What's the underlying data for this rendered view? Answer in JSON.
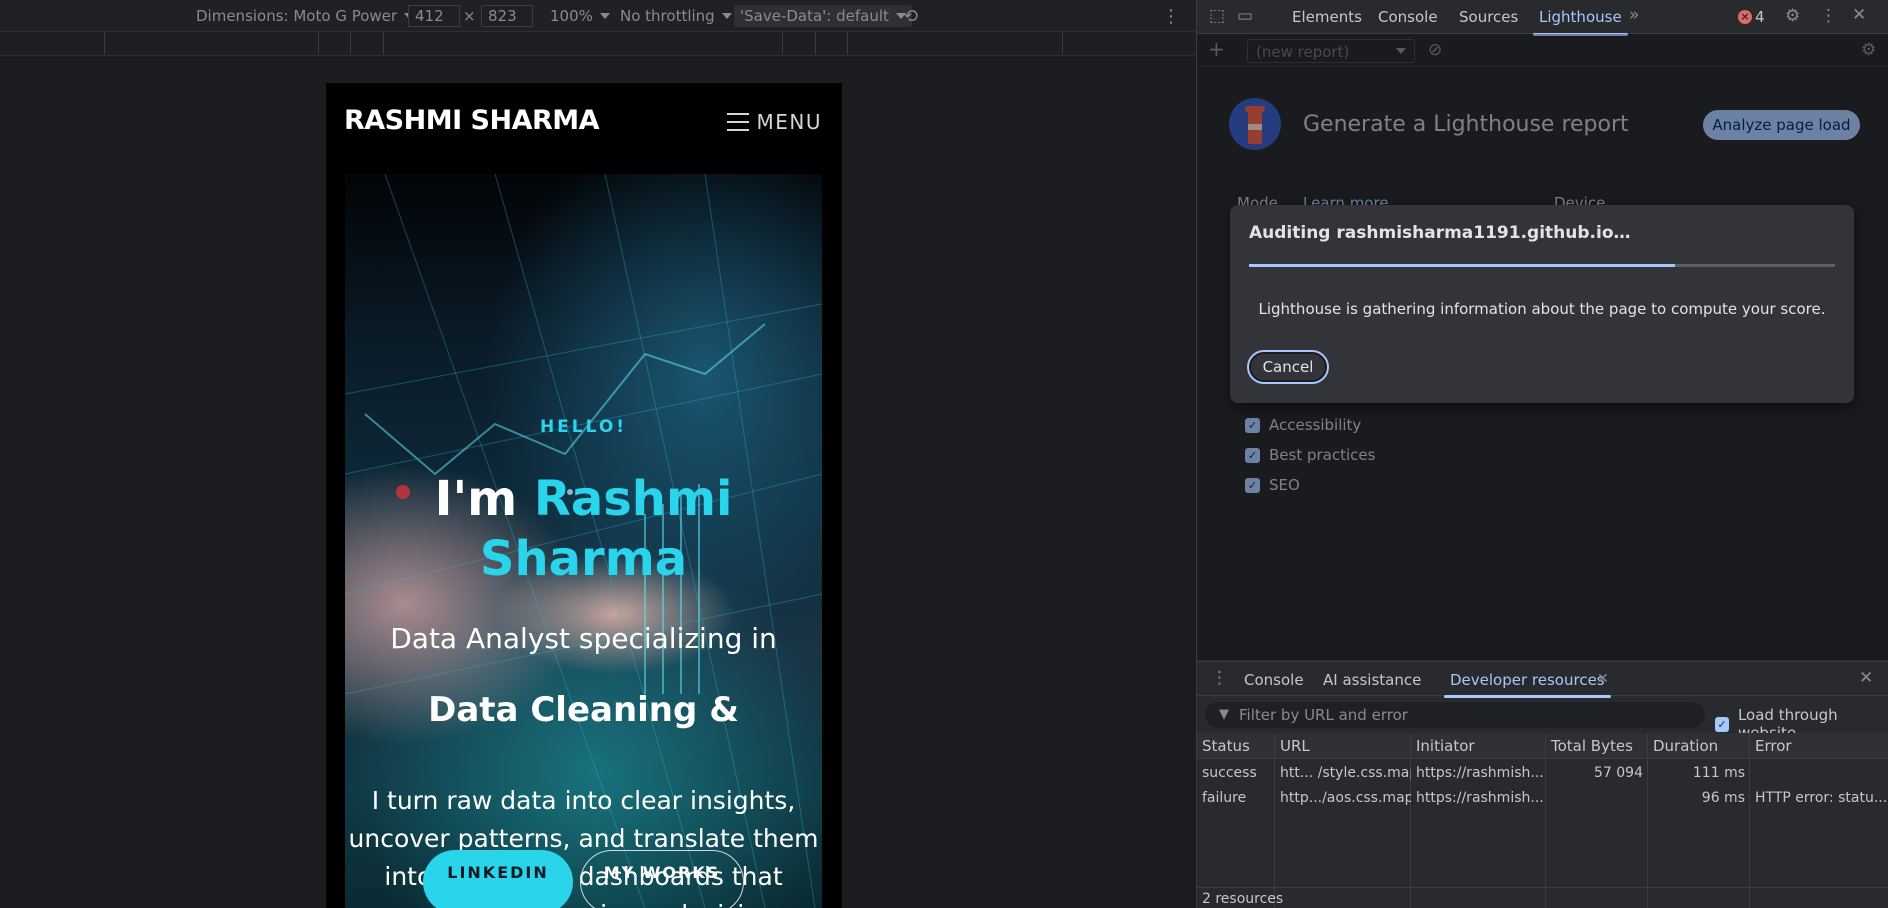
{
  "toolbar": {
    "dimensions": "Dimensions: Moto G Power",
    "width": "412",
    "times": "×",
    "height": "823",
    "zoom": "100%",
    "throttling": "No throttling",
    "save_data": "'Save-Data': default"
  },
  "site": {
    "brand": "RASHMI SHARMA",
    "menu_label": "MENU",
    "hello": "HELLO!",
    "im": "I'm ",
    "name_first": "Rashmi",
    "name_last": "Sharma",
    "specialty": "Data Analyst specializing in",
    "typed": "Data Cleaning &",
    "blurb": "I turn raw data into clear insights, uncover patterns, and translate them into actionable dashboards that support smart business decisions.",
    "linkedin": "LINKEDIN",
    "works": "MY WORKS"
  },
  "devtools": {
    "tabs": [
      "Elements",
      "Console",
      "Sources",
      "Lighthouse"
    ],
    "active_tab": "Lighthouse",
    "error_count": "4",
    "report_select": "(new report)",
    "lh_title": "Generate a Lighthouse report",
    "analyze_button": "Analyze page load",
    "mode_label": "Mode",
    "learn_more": "Learn more",
    "device_label": "Device",
    "categories": [
      "Accessibility",
      "Best practices",
      "SEO"
    ],
    "dialog": {
      "title": "Auditing rashmisharma1191.github.io…",
      "progress": 0.727,
      "message": "Lighthouse is gathering information about the page to compute your score.",
      "cancel": "Cancel"
    },
    "drawer": {
      "tabs": [
        "Console",
        "AI assistance",
        "Developer resources"
      ],
      "active_tab": "Developer resources",
      "filter_placeholder": "Filter by URL and error",
      "load_through": "Load through website",
      "columns": [
        "Status",
        "URL",
        "Initiator",
        "Total Bytes",
        "Duration",
        "Error"
      ],
      "rows": [
        [
          "success",
          "htt... /style.css.map",
          "https://rashmish...",
          "57 094",
          "111 ms",
          ""
        ],
        [
          "failure",
          "http.../aos.css.map",
          "https://rashmish...",
          "",
          "96 ms",
          "HTTP error: statu..."
        ]
      ],
      "footer": "2 resources"
    }
  },
  "colors": {
    "accent_cyan": "#2ad5ec",
    "devtools_accent": "#a8c7fa",
    "error_red": "#e46962"
  }
}
